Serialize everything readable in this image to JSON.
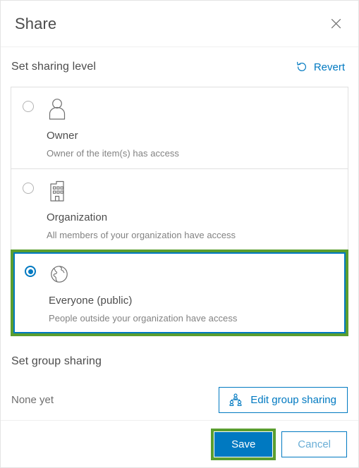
{
  "dialog": {
    "title": "Share",
    "close_icon": "close-icon"
  },
  "sharing_level": {
    "heading": "Set sharing level",
    "revert": {
      "label": "Revert",
      "icon": "revert-circular-arrow-icon"
    },
    "options": [
      {
        "id": "owner",
        "label": "Owner",
        "description": "Owner of the item(s) has access",
        "icon": "person-icon",
        "selected": false,
        "highlighted": false
      },
      {
        "id": "organization",
        "label": "Organization",
        "description": "All members of your organization have access",
        "icon": "building-icon",
        "selected": false,
        "highlighted": false
      },
      {
        "id": "everyone",
        "label": "Everyone (public)",
        "description": "People outside your organization have access",
        "icon": "globe-icon",
        "selected": true,
        "highlighted": true
      }
    ]
  },
  "group_sharing": {
    "heading": "Set group sharing",
    "status": "None yet",
    "edit_button": {
      "label": "Edit group sharing",
      "icon": "group-people-icon"
    }
  },
  "footer": {
    "save_label": "Save",
    "cancel_label": "Cancel"
  },
  "colors": {
    "accent_blue": "#0079c1",
    "highlight_green": "#5a9e2f",
    "text_primary": "#4c4c4c",
    "text_secondary": "#828282",
    "border": "#e0e0e0"
  }
}
